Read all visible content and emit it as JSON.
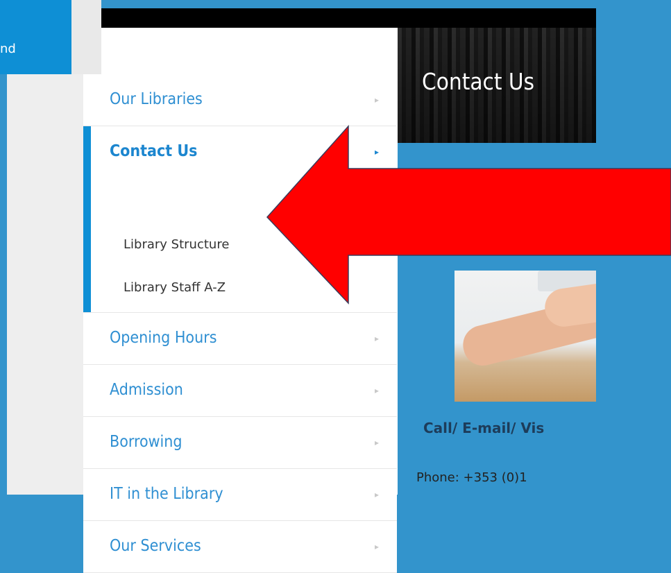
{
  "corner": {
    "text": "nd"
  },
  "menu": {
    "items": [
      {
        "label": "Our Libraries"
      },
      {
        "label": "Contact Us",
        "active": true,
        "subitems": [
          {
            "label": "Library Structure"
          },
          {
            "label": "Library Staff A-Z"
          }
        ]
      },
      {
        "label": "Opening Hours"
      },
      {
        "label": "Admission"
      },
      {
        "label": "Borrowing"
      },
      {
        "label": "IT in the Library"
      },
      {
        "label": "Our Services"
      }
    ],
    "chevron": "▸"
  },
  "banner": {
    "title": "Contact Us"
  },
  "content": {
    "heading": "Call/ E-mail/ Vis",
    "phone": "Phone: +353 (0)1"
  },
  "colors": {
    "accent": "#0e8fd5",
    "link": "#2f8fd2",
    "page_bg": "#3394cc",
    "arrow": "#ff0000"
  },
  "icons": {
    "arrow": "red-annotation-arrow-icon"
  }
}
